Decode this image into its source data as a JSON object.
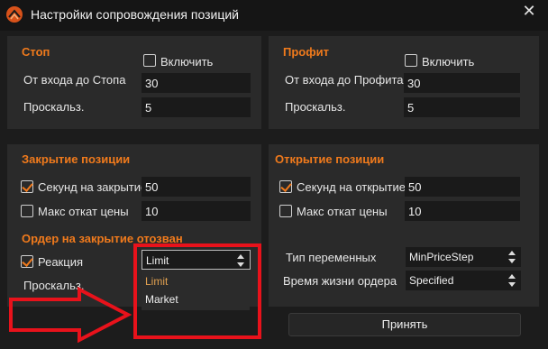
{
  "window": {
    "title": "Настройки сопровождения позиций",
    "close_glyph": "✕",
    "logo_icon": "app-logo-icon"
  },
  "stop": {
    "title": "Стоп",
    "enable_label": "Включить",
    "enabled": false,
    "entry_label": "От входа до Стопа",
    "entry_value": "30",
    "slippage_label": "Проскальз.",
    "slippage_value": "5"
  },
  "profit": {
    "title": "Профит",
    "enable_label": "Включить",
    "enabled": false,
    "entry_label": "От входа до Профита",
    "entry_value": "30",
    "slippage_label": "Проскальз.",
    "slippage_value": "5"
  },
  "close_position": {
    "title": "Закрытие позиции",
    "seconds_label": "Секунд на закрытие",
    "seconds_checked": true,
    "seconds_value": "50",
    "max_pullback_label": "Макс откат цены",
    "max_pullback_checked": false,
    "max_pullback_value": "10"
  },
  "close_order_canceled": {
    "title": "Ордер на закрытие отозван",
    "reaction_label": "Реакция",
    "reaction_checked": true,
    "reaction_value": "Limit",
    "reaction_options": [
      "Limit",
      "Market"
    ],
    "slippage_label": "Проскальз."
  },
  "open_position": {
    "title": "Открытие позиции",
    "seconds_label": "Секунд на открытие",
    "seconds_checked": true,
    "seconds_value": "50",
    "max_pullback_label": "Макс откат цены",
    "max_pullback_checked": false,
    "max_pullback_value": "10",
    "var_type_label": "Тип переменных",
    "var_type_value": "MinPriceStep",
    "order_lifetime_label": "Время жизни ордера",
    "order_lifetime_value": "Specified"
  },
  "actions": {
    "accept_label": "Принять"
  },
  "colors": {
    "accent": "#f07a1c",
    "annotation": "#e8121b",
    "background": "#1c1c1c",
    "panel": "#2a2a2a"
  }
}
